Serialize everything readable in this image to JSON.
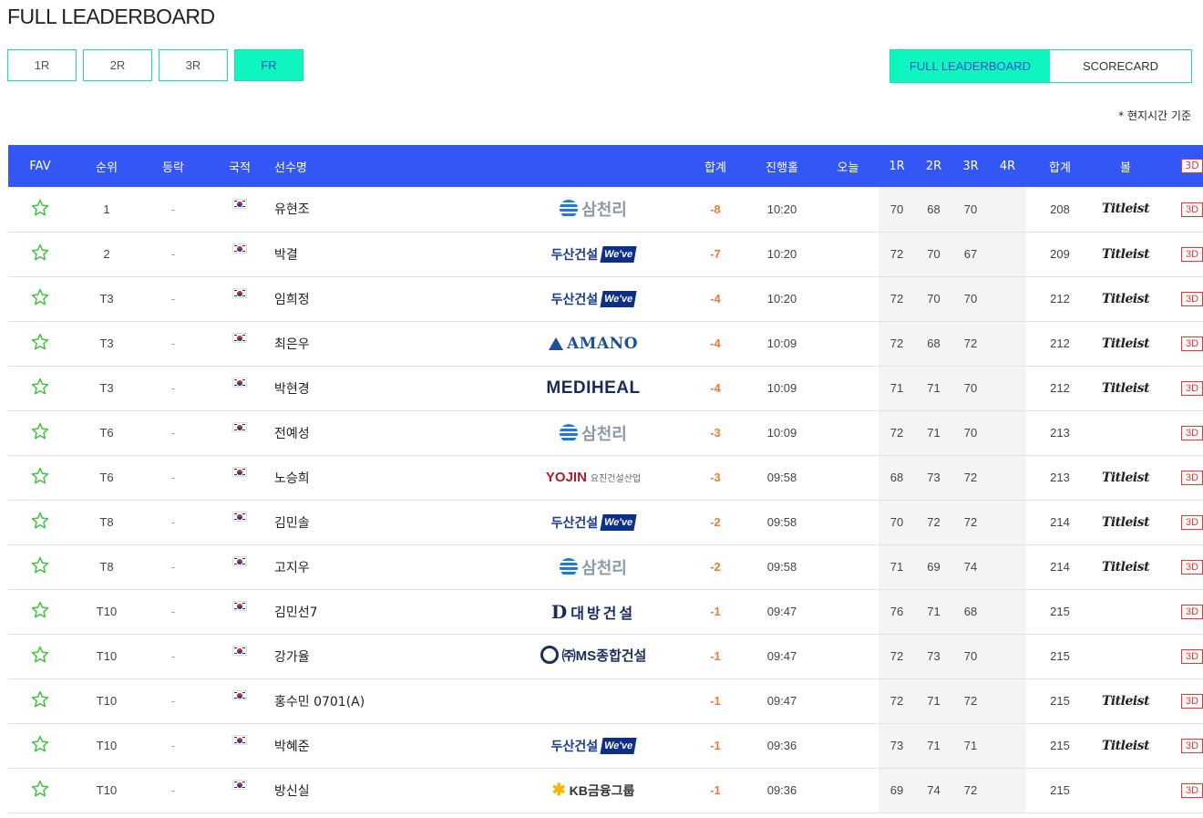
{
  "page": {
    "title": "FULL LEADERBOARD",
    "note": "* 현지시간 기준"
  },
  "round_tabs": [
    {
      "label": "1R",
      "active": false
    },
    {
      "label": "2R",
      "active": false
    },
    {
      "label": "3R",
      "active": false
    },
    {
      "label": "FR",
      "active": true
    }
  ],
  "view_tabs": [
    {
      "label": "FULL LEADERBOARD",
      "active": true
    },
    {
      "label": "SCORECARD",
      "active": false
    }
  ],
  "colors": {
    "header_bg": "#3356f5",
    "accent": "#0ef5c0",
    "score": "#f07a32",
    "three_d": "#e33333"
  },
  "columns": {
    "fav": "FAV",
    "rank": "순위",
    "move": "등락",
    "nation": "국적",
    "name": "선수명",
    "total": "합계",
    "hole": "진행홀",
    "today": "오늘",
    "r1": "1R",
    "r2": "2R",
    "r3": "3R",
    "r4": "4R",
    "sum": "합계",
    "ball": "볼",
    "three_d": "3D"
  },
  "rows": [
    {
      "rank": "1",
      "move": "-",
      "name": "유현조",
      "sponsor": "samchully",
      "total": "-8",
      "hole": "10:20",
      "today": "",
      "r1": "70",
      "r2": "68",
      "r3": "70",
      "r4": "",
      "sum": "208",
      "ball": "Titleist",
      "three_d": "3D"
    },
    {
      "rank": "2",
      "move": "-",
      "name": "박결",
      "sponsor": "doosan",
      "total": "-7",
      "hole": "10:20",
      "today": "",
      "r1": "72",
      "r2": "70",
      "r3": "67",
      "r4": "",
      "sum": "209",
      "ball": "Titleist",
      "three_d": "3D"
    },
    {
      "rank": "T3",
      "move": "-",
      "name": "임희정",
      "sponsor": "doosan",
      "total": "-4",
      "hole": "10:20",
      "today": "",
      "r1": "72",
      "r2": "70",
      "r3": "70",
      "r4": "",
      "sum": "212",
      "ball": "Titleist",
      "three_d": "3D"
    },
    {
      "rank": "T3",
      "move": "-",
      "name": "최은우",
      "sponsor": "amano",
      "total": "-4",
      "hole": "10:09",
      "today": "",
      "r1": "72",
      "r2": "68",
      "r3": "72",
      "r4": "",
      "sum": "212",
      "ball": "Titleist",
      "three_d": "3D"
    },
    {
      "rank": "T3",
      "move": "-",
      "name": "박현경",
      "sponsor": "mediheal",
      "total": "-4",
      "hole": "10:09",
      "today": "",
      "r1": "71",
      "r2": "71",
      "r3": "70",
      "r4": "",
      "sum": "212",
      "ball": "Titleist",
      "three_d": "3D"
    },
    {
      "rank": "T6",
      "move": "-",
      "name": "전예성",
      "sponsor": "samchully",
      "total": "-3",
      "hole": "10:09",
      "today": "",
      "r1": "72",
      "r2": "71",
      "r3": "70",
      "r4": "",
      "sum": "213",
      "ball": "",
      "three_d": "3D"
    },
    {
      "rank": "T6",
      "move": "-",
      "name": "노승희",
      "sponsor": "yojin",
      "total": "-3",
      "hole": "09:58",
      "today": "",
      "r1": "68",
      "r2": "73",
      "r3": "72",
      "r4": "",
      "sum": "213",
      "ball": "Titleist",
      "three_d": "3D"
    },
    {
      "rank": "T8",
      "move": "-",
      "name": "김민솔",
      "sponsor": "doosan",
      "total": "-2",
      "hole": "09:58",
      "today": "",
      "r1": "70",
      "r2": "72",
      "r3": "72",
      "r4": "",
      "sum": "214",
      "ball": "Titleist",
      "three_d": "3D"
    },
    {
      "rank": "T8",
      "move": "-",
      "name": "고지우",
      "sponsor": "samchully",
      "total": "-2",
      "hole": "09:58",
      "today": "",
      "r1": "71",
      "r2": "69",
      "r3": "74",
      "r4": "",
      "sum": "214",
      "ball": "Titleist",
      "three_d": "3D"
    },
    {
      "rank": "T10",
      "move": "-",
      "name": "김민선7",
      "sponsor": "daebang",
      "total": "-1",
      "hole": "09:47",
      "today": "",
      "r1": "76",
      "r2": "71",
      "r3": "68",
      "r4": "",
      "sum": "215",
      "ball": "",
      "three_d": "3D"
    },
    {
      "rank": "T10",
      "move": "-",
      "name": "강가율",
      "sponsor": "ms",
      "total": "-1",
      "hole": "09:47",
      "today": "",
      "r1": "72",
      "r2": "73",
      "r3": "70",
      "r4": "",
      "sum": "215",
      "ball": "",
      "three_d": "3D"
    },
    {
      "rank": "T10",
      "move": "-",
      "name": "홍수민 0701(A)",
      "sponsor": "",
      "total": "-1",
      "hole": "09:47",
      "today": "",
      "r1": "72",
      "r2": "71",
      "r3": "72",
      "r4": "",
      "sum": "215",
      "ball": "Titleist",
      "three_d": "3D"
    },
    {
      "rank": "T10",
      "move": "-",
      "name": "박혜준",
      "sponsor": "doosan",
      "total": "-1",
      "hole": "09:36",
      "today": "",
      "r1": "73",
      "r2": "71",
      "r3": "71",
      "r4": "",
      "sum": "215",
      "ball": "Titleist",
      "three_d": "3D"
    },
    {
      "rank": "T10",
      "move": "-",
      "name": "방신실",
      "sponsor": "kb",
      "total": "-1",
      "hole": "09:36",
      "today": "",
      "r1": "69",
      "r2": "74",
      "r3": "72",
      "r4": "",
      "sum": "215",
      "ball": "",
      "three_d": "3D"
    }
  ],
  "sponsor_logos": {
    "samchully": "삼천리",
    "doosan": {
      "main": "두산건설",
      "badge": "We've"
    },
    "amano": "AMANO",
    "mediheal": "MEDIHEAL",
    "yojin": {
      "main": "YOJIN",
      "sub": "요진건설산업"
    },
    "daebang": {
      "mark": "D",
      "main": "대방건설"
    },
    "ms": "㈜MS종합건설",
    "kb": "KB금융그룹"
  }
}
